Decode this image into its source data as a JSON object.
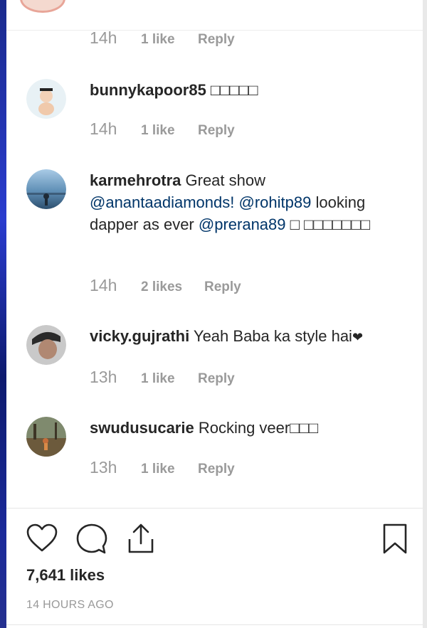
{
  "top_comment": {
    "time": "14h",
    "likes": "1 like",
    "reply": "Reply"
  },
  "comments": [
    {
      "username": "bunnykapoor85",
      "text": " □□□□□",
      "time": "14h",
      "likes": "1 like",
      "reply": "Reply"
    },
    {
      "username": "karmehrotra",
      "text_a": " Great show ",
      "mention_1": "@anantaadiamonds!",
      "text_b": " ",
      "mention_2": "@rohitp89",
      "text_c": " looking dapper as ever ",
      "mention_3": "@prerana89",
      "text_d": " □ □□□□□□□",
      "time": "14h",
      "likes": "2 likes",
      "reply": "Reply"
    },
    {
      "username": "vicky.gujrathi",
      "text": " Yeah Baba ka style hai",
      "heart": "❤",
      "time": "13h",
      "likes": "1 like",
      "reply": "Reply"
    },
    {
      "username": "swudusucarie",
      "text": " Rocking veer□□□",
      "time": "13h",
      "likes": "1 like",
      "reply": "Reply"
    }
  ],
  "actions": {
    "like_icon": "heart-outline-icon",
    "comment_icon": "speech-bubble-icon",
    "share_icon": "share-upload-icon",
    "save_icon": "bookmark-icon"
  },
  "post": {
    "likes_count": "7,641 likes",
    "posted_ago": "14 HOURS AGO"
  },
  "colors": {
    "mention": "#003569",
    "muted": "#999999",
    "text": "#262626"
  }
}
